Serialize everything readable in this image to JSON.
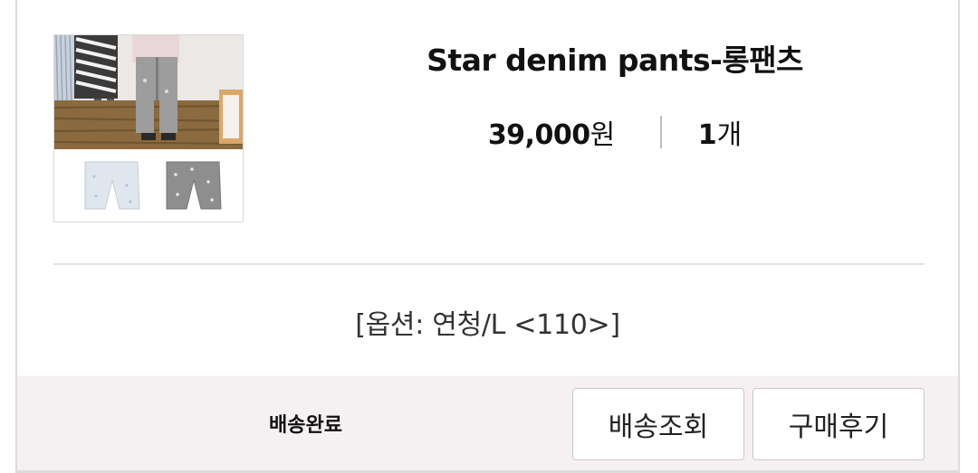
{
  "product": {
    "name": "Star denim pants-롱팬츠",
    "price": "39,000",
    "price_unit": "원",
    "quantity": "1",
    "quantity_unit": "개",
    "option": "[옵션: 연청/L <110>]"
  },
  "delivery": {
    "status": "배송완료",
    "track_label": "배송조회",
    "review_label": "구매후기"
  }
}
